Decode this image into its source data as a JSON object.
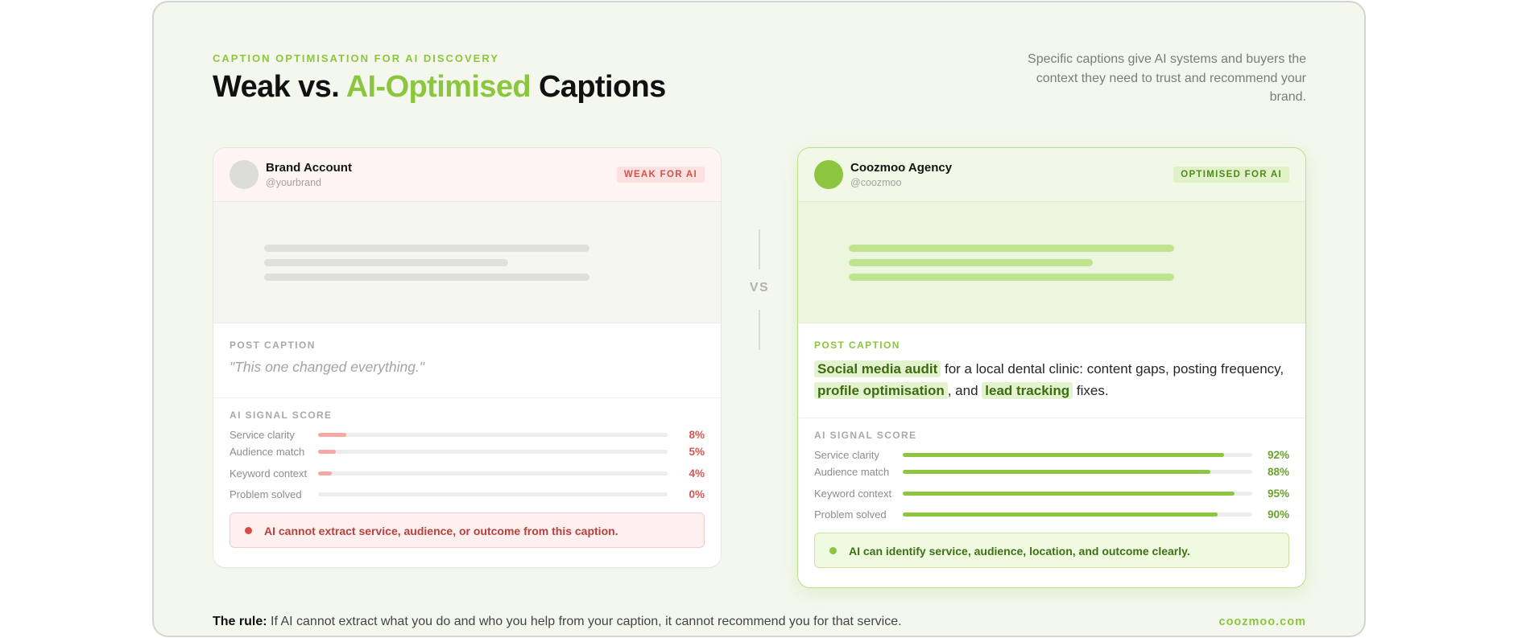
{
  "header": {
    "eyebrow": "CAPTION OPTIMISATION FOR AI DISCOVERY",
    "title_part1": "Weak vs. ",
    "title_accent": "AI-Optimised",
    "title_part2": " Captions",
    "subtitle": "Specific captions give AI systems and buyers the context they need to trust and recommend your brand."
  },
  "weak_card": {
    "account_name": "Brand Account",
    "account_handle": "@yourbrand",
    "badge": "WEAK FOR AI",
    "caption_label": "POST CAPTION",
    "caption": "\"This one changed everything.\"",
    "score_label": "AI SIGNAL SCORE",
    "scores": [
      {
        "label": "Service clarity",
        "value": 8,
        "display": "8%"
      },
      {
        "label": "Audience match",
        "value": 5,
        "display": "5%"
      },
      {
        "label": "Keyword context",
        "value": 4,
        "display": "4%"
      },
      {
        "label": "Problem solved",
        "value": 0,
        "display": "0%"
      }
    ],
    "verdict": "AI cannot extract service, audience, or outcome from this caption."
  },
  "strong_card": {
    "account_name": "Coozmoo Agency",
    "account_handle": "@coozmoo",
    "badge": "OPTIMISED FOR AI",
    "caption_label": "POST CAPTION",
    "caption_segments": {
      "hl1": "Social media audit",
      "t1": " for a local dental clinic: content gaps, posting frequency, ",
      "hl2": "profile optimisation",
      "t2": ", and ",
      "hl3": "lead tracking",
      "t3": " fixes."
    },
    "score_label": "AI SIGNAL SCORE",
    "scores": [
      {
        "label": "Service clarity",
        "value": 92,
        "display": "92%"
      },
      {
        "label": "Audience match",
        "value": 88,
        "display": "88%"
      },
      {
        "label": "Keyword context",
        "value": 95,
        "display": "95%"
      },
      {
        "label": "Problem solved",
        "value": 90,
        "display": "90%"
      }
    ],
    "verdict": "AI can identify service, audience, location, and outcome clearly."
  },
  "divider": {
    "label": "VS"
  },
  "footer": {
    "rule_label": "The rule:",
    "rule_text": " If AI cannot extract what you do and who you help from your caption, it cannot recommend you for that service.",
    "domain": "coozmoo.com"
  },
  "colors": {
    "accent": "#8cc63f",
    "weak": "#d25653",
    "background": "#f4f7ee"
  }
}
